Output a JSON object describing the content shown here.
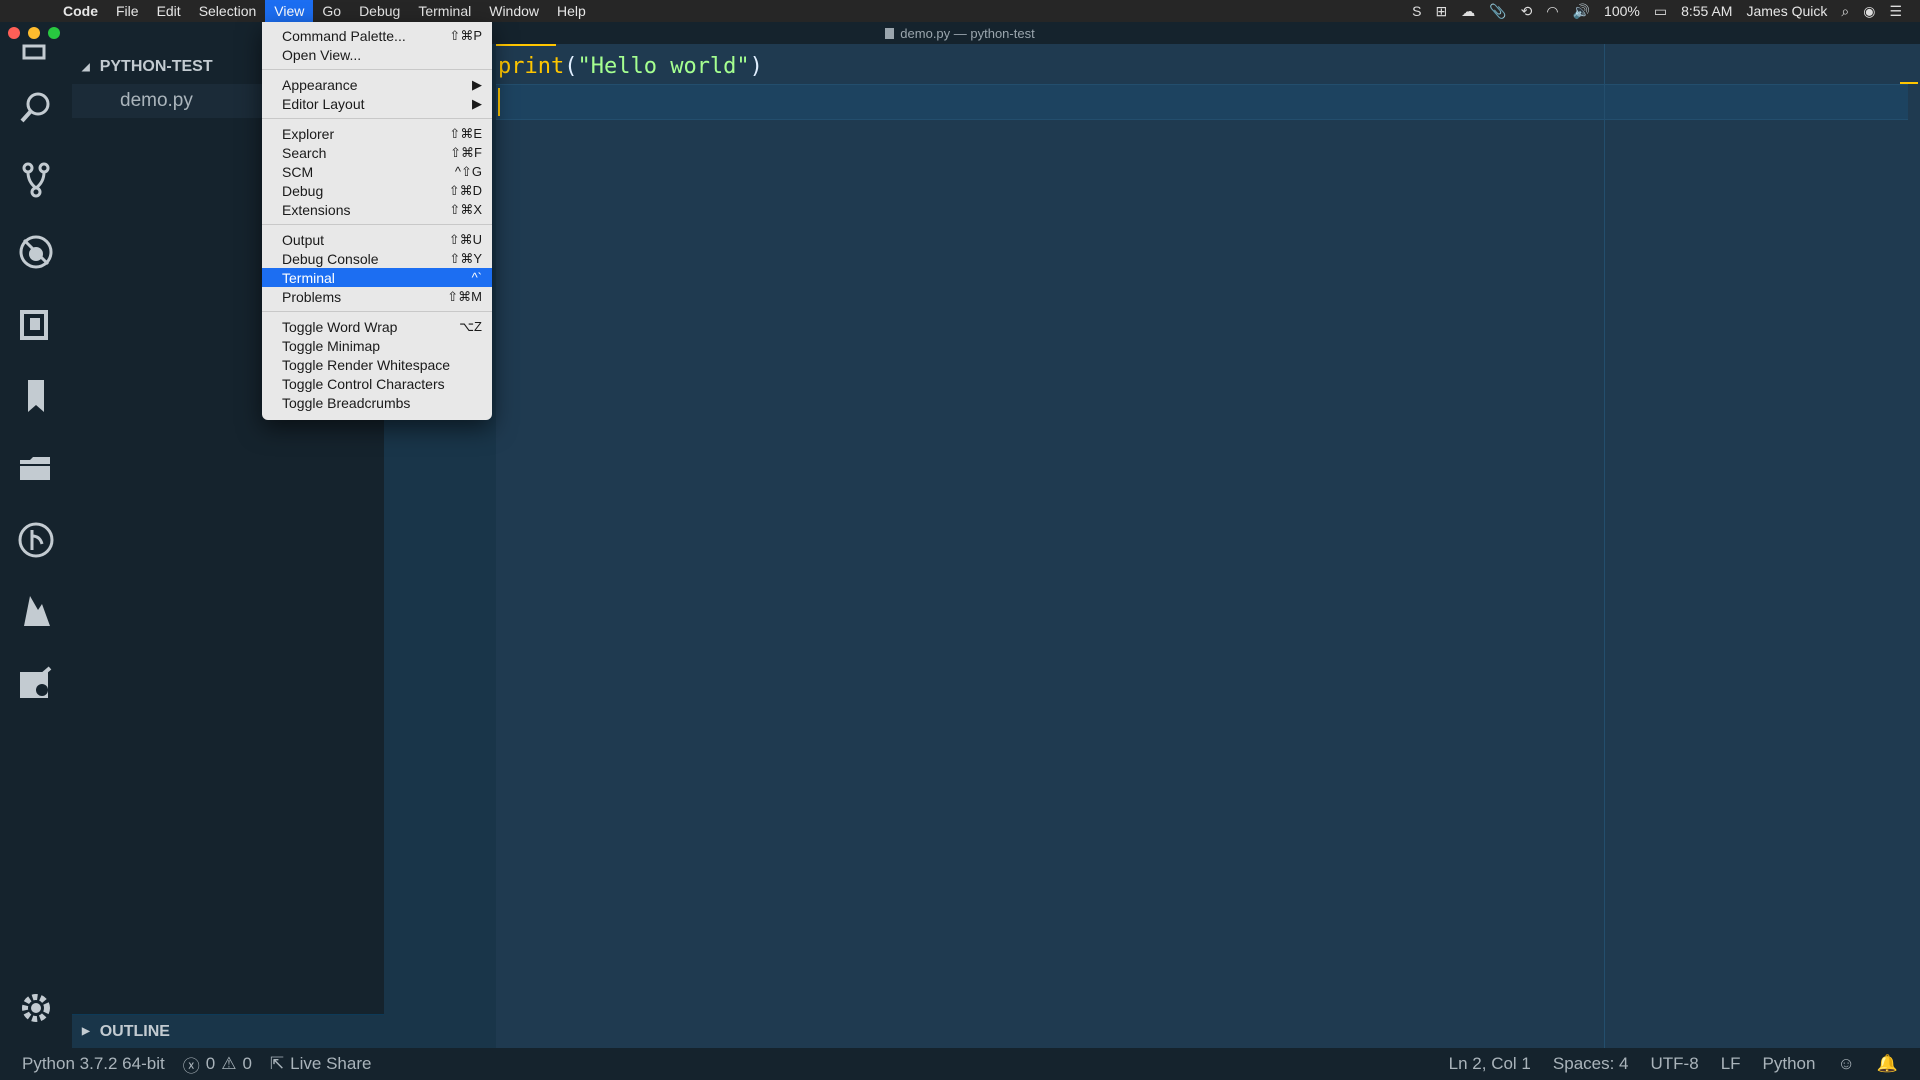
{
  "menubar": {
    "app": "Code",
    "menus": [
      "File",
      "Edit",
      "Selection",
      "View",
      "Go",
      "Debug",
      "Terminal",
      "Window",
      "Help"
    ],
    "active_menu": "View",
    "battery": "100%",
    "time": "8:55 AM",
    "user": "James Quick"
  },
  "window": {
    "title": "demo.py — python-test"
  },
  "sidebar": {
    "folder": "PYTHON-TEST",
    "file": "demo.py",
    "outline": "OUTLINE"
  },
  "editor": {
    "fn": "print",
    "open_paren": "(",
    "string": "\"Hello world\"",
    "close_paren": ")"
  },
  "view_menu": {
    "groups": [
      [
        {
          "label": "Command Palette...",
          "shortcut": "⇧⌘P"
        },
        {
          "label": "Open View...",
          "shortcut": ""
        }
      ],
      [
        {
          "label": "Appearance",
          "shortcut": "▶"
        },
        {
          "label": "Editor Layout",
          "shortcut": "▶"
        }
      ],
      [
        {
          "label": "Explorer",
          "shortcut": "⇧⌘E"
        },
        {
          "label": "Search",
          "shortcut": "⇧⌘F"
        },
        {
          "label": "SCM",
          "shortcut": "^⇧G"
        },
        {
          "label": "Debug",
          "shortcut": "⇧⌘D"
        },
        {
          "label": "Extensions",
          "shortcut": "⇧⌘X"
        }
      ],
      [
        {
          "label": "Output",
          "shortcut": "⇧⌘U"
        },
        {
          "label": "Debug Console",
          "shortcut": "⇧⌘Y"
        },
        {
          "label": "Terminal",
          "shortcut": "^`"
        },
        {
          "label": "Problems",
          "shortcut": "⇧⌘M"
        }
      ],
      [
        {
          "label": "Toggle Word Wrap",
          "shortcut": "⌥Z"
        },
        {
          "label": "Toggle Minimap",
          "shortcut": ""
        },
        {
          "label": "Toggle Render Whitespace",
          "shortcut": ""
        },
        {
          "label": "Toggle Control Characters",
          "shortcut": ""
        },
        {
          "label": "Toggle Breadcrumbs",
          "shortcut": ""
        }
      ]
    ],
    "highlighted": "Terminal"
  },
  "statusbar": {
    "python": "Python 3.7.2 64-bit",
    "errors": "0",
    "warnings": "0",
    "live_share": "Live Share",
    "position": "Ln 2, Col 1",
    "spaces": "Spaces: 4",
    "encoding": "UTF-8",
    "eol": "LF",
    "language": "Python"
  },
  "colors": {
    "editor_bg": "#193549",
    "accent": "#ffc600",
    "string": "#a5ff90",
    "menu_highlight": "#1c6ef2"
  }
}
